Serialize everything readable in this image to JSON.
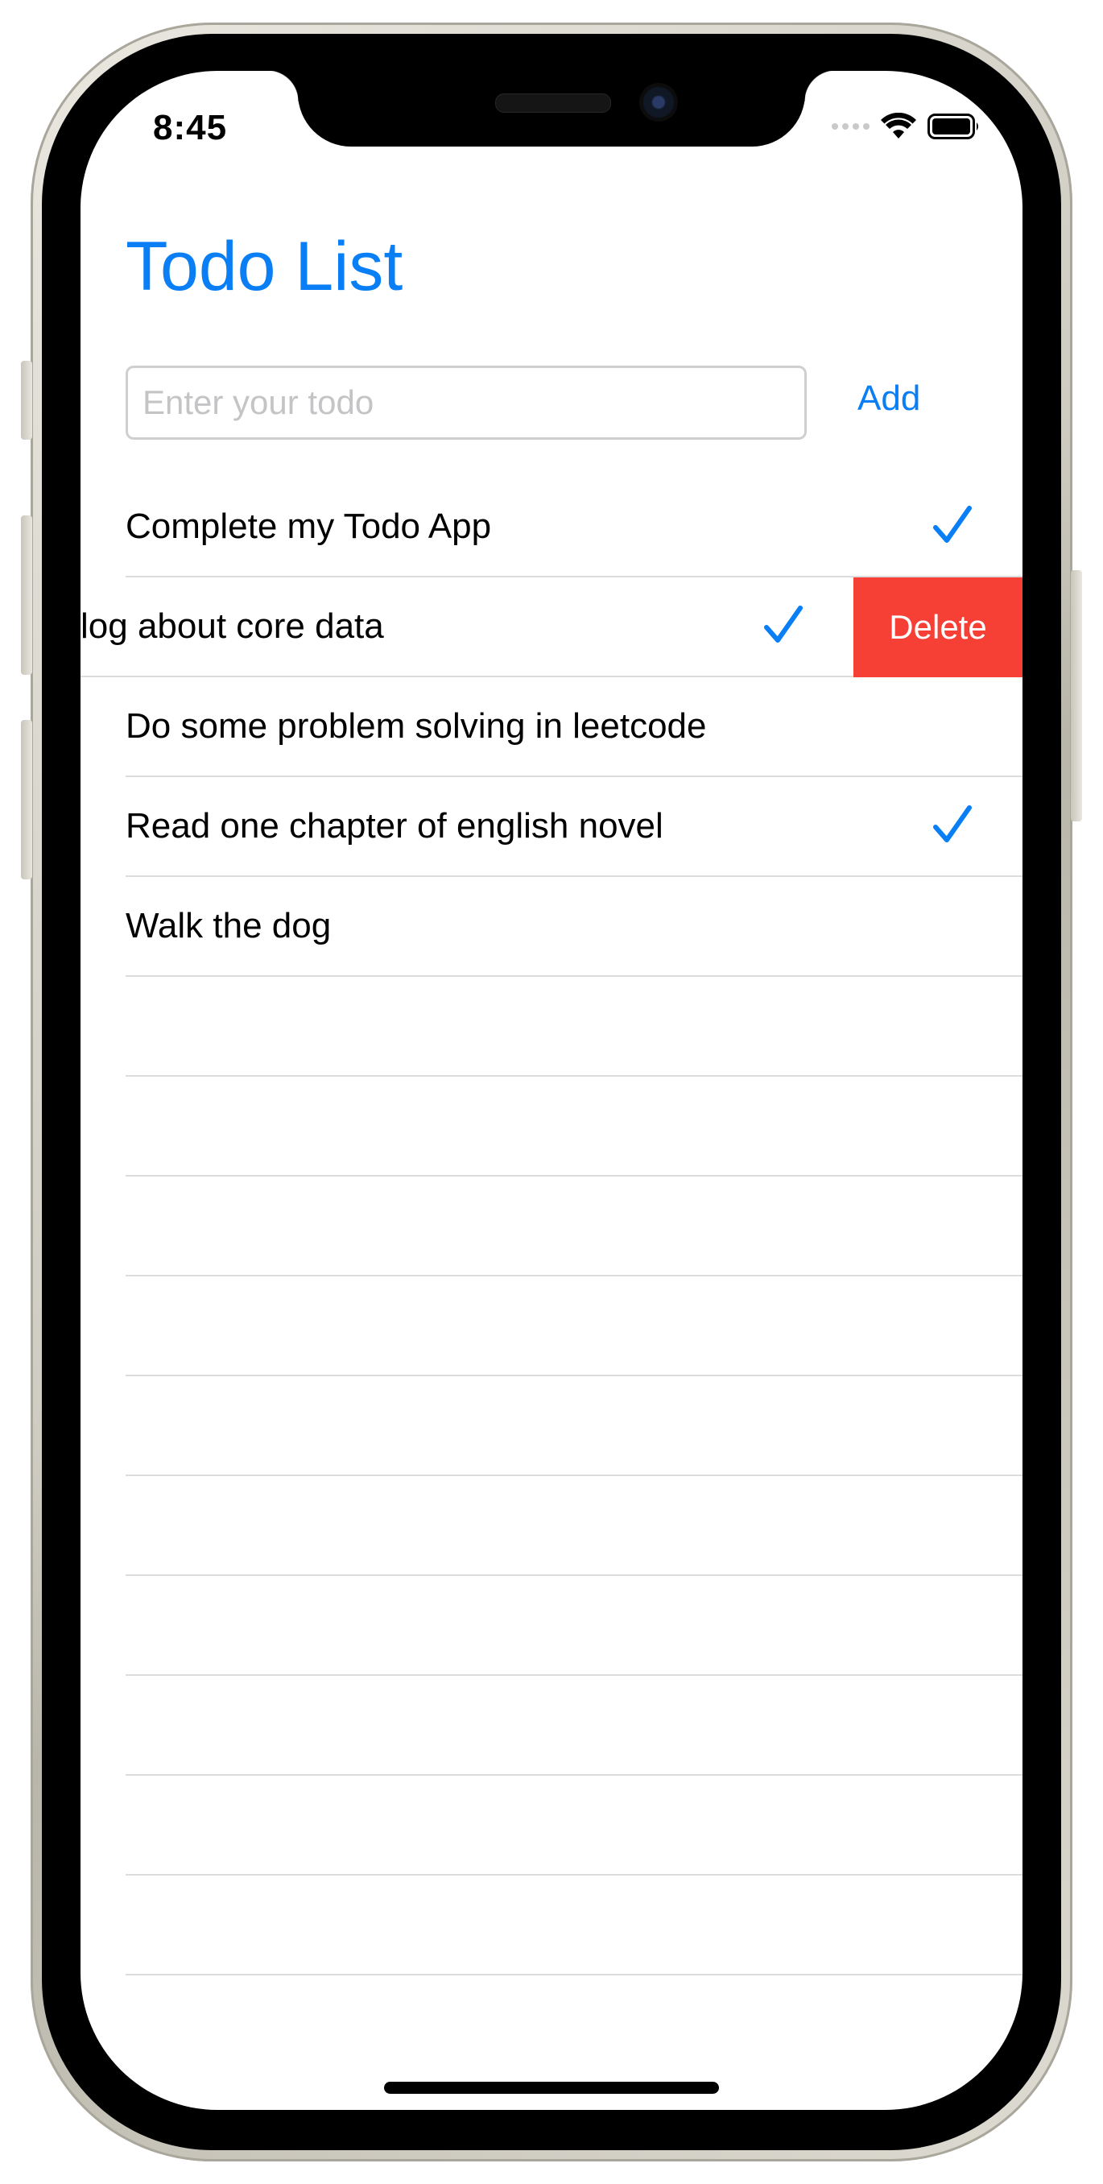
{
  "status_bar": {
    "time": "8:45"
  },
  "app": {
    "title": "Todo List",
    "input_placeholder": "Enter your todo",
    "add_label": "Add"
  },
  "todos": [
    {
      "text": "Complete my Todo App",
      "checked": true
    },
    {
      "text": "log about core data",
      "checked": true,
      "swiped": true
    },
    {
      "text": "Do some problem solving in leetcode",
      "checked": false
    },
    {
      "text": "Read one chapter of english novel",
      "checked": true
    },
    {
      "text": "Walk the dog",
      "checked": false
    }
  ],
  "swipe_action": {
    "label": "Delete"
  },
  "colors": {
    "accent": "#0a7ff5",
    "delete": "#f63f35",
    "separator": "#dcdcdf"
  }
}
